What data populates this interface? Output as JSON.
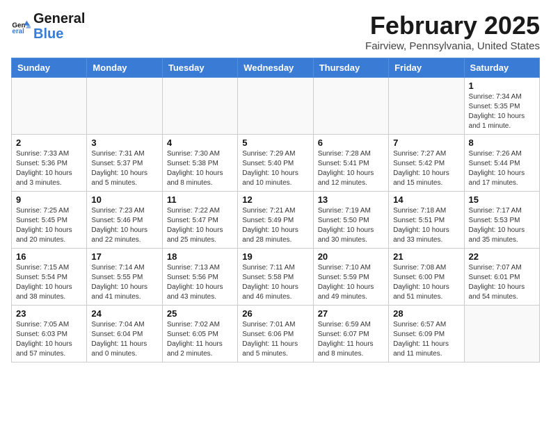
{
  "logo": {
    "general": "General",
    "blue": "Blue"
  },
  "header": {
    "title": "February 2025",
    "subtitle": "Fairview, Pennsylvania, United States"
  },
  "weekdays": [
    "Sunday",
    "Monday",
    "Tuesday",
    "Wednesday",
    "Thursday",
    "Friday",
    "Saturday"
  ],
  "weeks": [
    [
      {
        "day": "",
        "info": ""
      },
      {
        "day": "",
        "info": ""
      },
      {
        "day": "",
        "info": ""
      },
      {
        "day": "",
        "info": ""
      },
      {
        "day": "",
        "info": ""
      },
      {
        "day": "",
        "info": ""
      },
      {
        "day": "1",
        "info": "Sunrise: 7:34 AM\nSunset: 5:35 PM\nDaylight: 10 hours and 1 minute."
      }
    ],
    [
      {
        "day": "2",
        "info": "Sunrise: 7:33 AM\nSunset: 5:36 PM\nDaylight: 10 hours and 3 minutes."
      },
      {
        "day": "3",
        "info": "Sunrise: 7:31 AM\nSunset: 5:37 PM\nDaylight: 10 hours and 5 minutes."
      },
      {
        "day": "4",
        "info": "Sunrise: 7:30 AM\nSunset: 5:38 PM\nDaylight: 10 hours and 8 minutes."
      },
      {
        "day": "5",
        "info": "Sunrise: 7:29 AM\nSunset: 5:40 PM\nDaylight: 10 hours and 10 minutes."
      },
      {
        "day": "6",
        "info": "Sunrise: 7:28 AM\nSunset: 5:41 PM\nDaylight: 10 hours and 12 minutes."
      },
      {
        "day": "7",
        "info": "Sunrise: 7:27 AM\nSunset: 5:42 PM\nDaylight: 10 hours and 15 minutes."
      },
      {
        "day": "8",
        "info": "Sunrise: 7:26 AM\nSunset: 5:44 PM\nDaylight: 10 hours and 17 minutes."
      }
    ],
    [
      {
        "day": "9",
        "info": "Sunrise: 7:25 AM\nSunset: 5:45 PM\nDaylight: 10 hours and 20 minutes."
      },
      {
        "day": "10",
        "info": "Sunrise: 7:23 AM\nSunset: 5:46 PM\nDaylight: 10 hours and 22 minutes."
      },
      {
        "day": "11",
        "info": "Sunrise: 7:22 AM\nSunset: 5:47 PM\nDaylight: 10 hours and 25 minutes."
      },
      {
        "day": "12",
        "info": "Sunrise: 7:21 AM\nSunset: 5:49 PM\nDaylight: 10 hours and 28 minutes."
      },
      {
        "day": "13",
        "info": "Sunrise: 7:19 AM\nSunset: 5:50 PM\nDaylight: 10 hours and 30 minutes."
      },
      {
        "day": "14",
        "info": "Sunrise: 7:18 AM\nSunset: 5:51 PM\nDaylight: 10 hours and 33 minutes."
      },
      {
        "day": "15",
        "info": "Sunrise: 7:17 AM\nSunset: 5:53 PM\nDaylight: 10 hours and 35 minutes."
      }
    ],
    [
      {
        "day": "16",
        "info": "Sunrise: 7:15 AM\nSunset: 5:54 PM\nDaylight: 10 hours and 38 minutes."
      },
      {
        "day": "17",
        "info": "Sunrise: 7:14 AM\nSunset: 5:55 PM\nDaylight: 10 hours and 41 minutes."
      },
      {
        "day": "18",
        "info": "Sunrise: 7:13 AM\nSunset: 5:56 PM\nDaylight: 10 hours and 43 minutes."
      },
      {
        "day": "19",
        "info": "Sunrise: 7:11 AM\nSunset: 5:58 PM\nDaylight: 10 hours and 46 minutes."
      },
      {
        "day": "20",
        "info": "Sunrise: 7:10 AM\nSunset: 5:59 PM\nDaylight: 10 hours and 49 minutes."
      },
      {
        "day": "21",
        "info": "Sunrise: 7:08 AM\nSunset: 6:00 PM\nDaylight: 10 hours and 51 minutes."
      },
      {
        "day": "22",
        "info": "Sunrise: 7:07 AM\nSunset: 6:01 PM\nDaylight: 10 hours and 54 minutes."
      }
    ],
    [
      {
        "day": "23",
        "info": "Sunrise: 7:05 AM\nSunset: 6:03 PM\nDaylight: 10 hours and 57 minutes."
      },
      {
        "day": "24",
        "info": "Sunrise: 7:04 AM\nSunset: 6:04 PM\nDaylight: 11 hours and 0 minutes."
      },
      {
        "day": "25",
        "info": "Sunrise: 7:02 AM\nSunset: 6:05 PM\nDaylight: 11 hours and 2 minutes."
      },
      {
        "day": "26",
        "info": "Sunrise: 7:01 AM\nSunset: 6:06 PM\nDaylight: 11 hours and 5 minutes."
      },
      {
        "day": "27",
        "info": "Sunrise: 6:59 AM\nSunset: 6:07 PM\nDaylight: 11 hours and 8 minutes."
      },
      {
        "day": "28",
        "info": "Sunrise: 6:57 AM\nSunset: 6:09 PM\nDaylight: 11 hours and 11 minutes."
      },
      {
        "day": "",
        "info": ""
      }
    ]
  ]
}
